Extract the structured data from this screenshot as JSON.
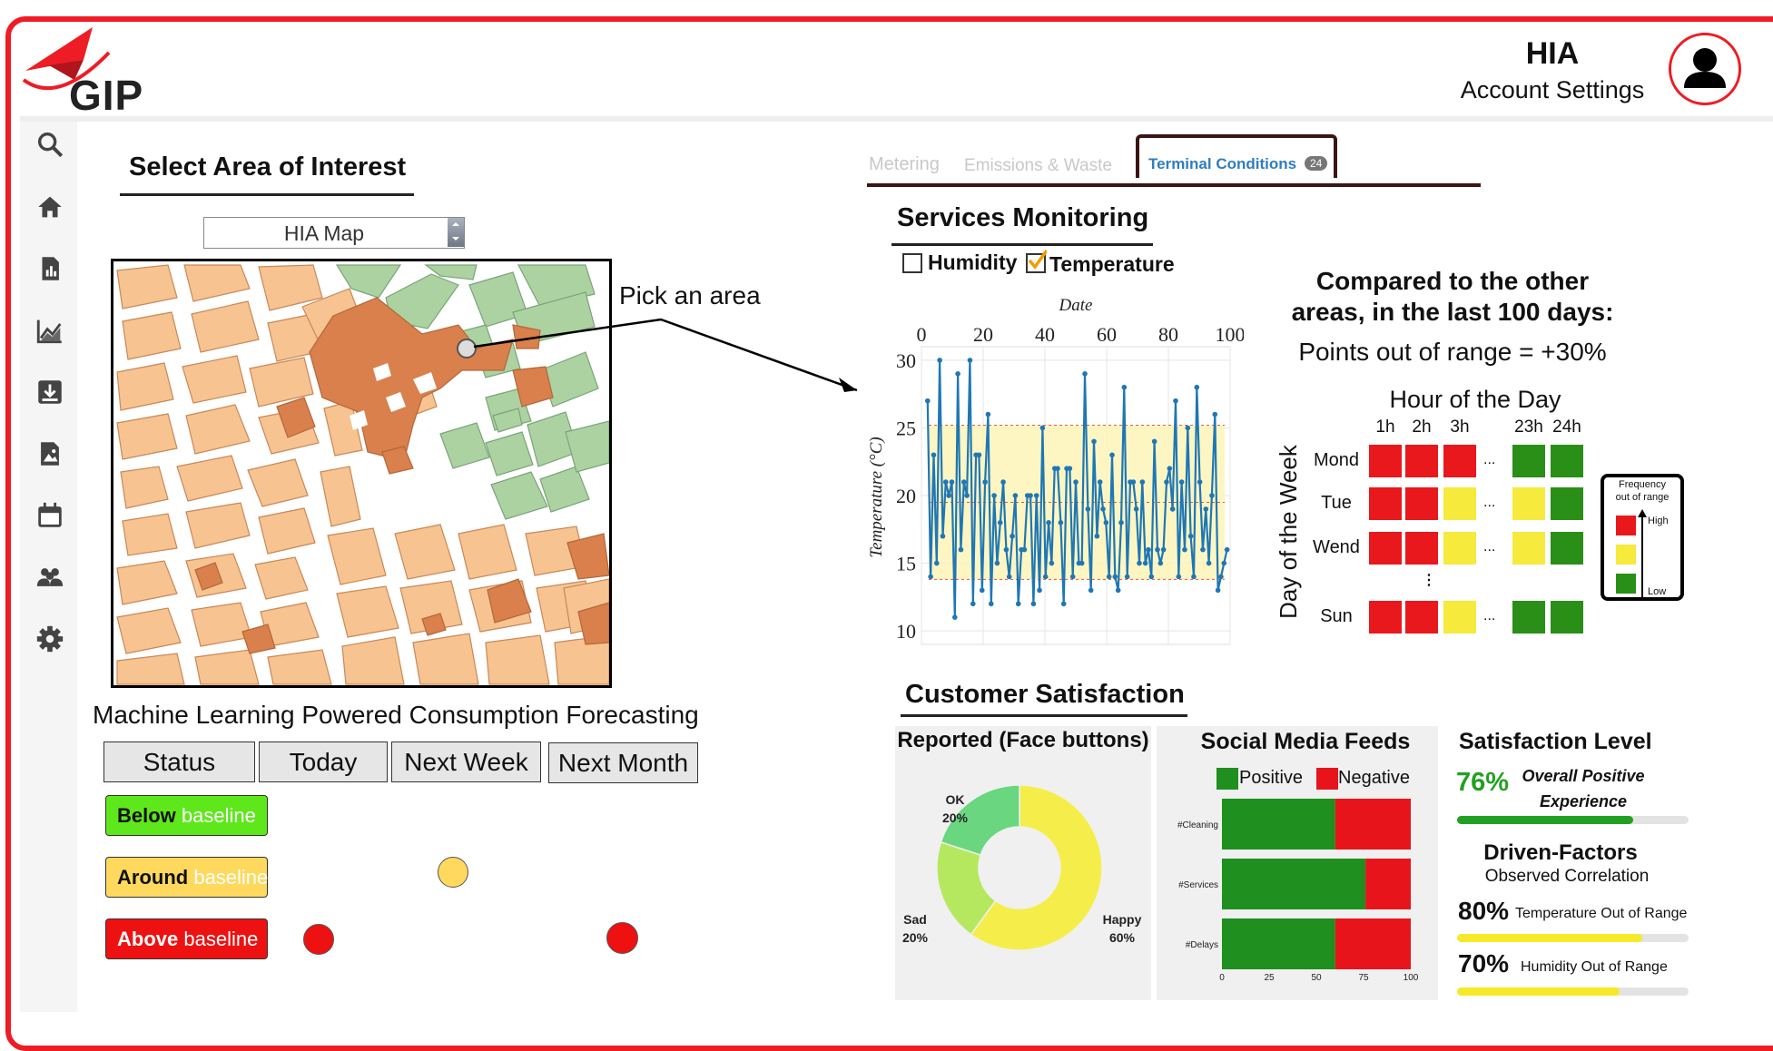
{
  "app": {
    "logo_text": "GIP",
    "account_name": "HIA",
    "account_settings": "Account Settings"
  },
  "sidebar": {
    "items": [
      {
        "icon": "search-icon"
      },
      {
        "icon": "home-icon"
      },
      {
        "icon": "report-icon"
      },
      {
        "icon": "chart-icon"
      },
      {
        "icon": "download-icon"
      },
      {
        "icon": "image-file-icon"
      },
      {
        "icon": "calendar-icon"
      },
      {
        "icon": "users-icon"
      },
      {
        "icon": "gear-icon"
      }
    ]
  },
  "area": {
    "title": "Select Area of Interest",
    "select_value": "HIA Map",
    "pick_label": "Pick an area"
  },
  "forecast": {
    "title": "Machine Learning Powered Consumption Forecasting",
    "buttons": [
      "Status",
      "Today",
      "Next Week",
      "Next Month"
    ],
    "legend": [
      {
        "bold": "Below",
        "sub": "baseline",
        "color": "#5ee81b"
      },
      {
        "bold": "Around",
        "sub": "baseline",
        "color": "#ffd95e"
      },
      {
        "bold": "Above",
        "sub": "baseline",
        "color": "#ee1111"
      }
    ]
  },
  "tabs": {
    "items": [
      "Metering",
      "Emissions & Waste",
      "Terminal Conditions"
    ],
    "active_badge": "24"
  },
  "services": {
    "title": "Services Monitoring",
    "humidity_label": "Humidity",
    "temperature_label": "Temperature",
    "humidity_checked": false,
    "temperature_checked": true
  },
  "comparison": {
    "title_line1": "Compared to the other",
    "title_line2": "areas, in the last 100 days:",
    "points_out": "Points out of range = +30%"
  },
  "heatmap": {
    "title": "Hour of the Day",
    "ylabel": "Day of the Week",
    "hours": [
      "1h",
      "2h",
      "3h",
      "23h",
      "24h"
    ],
    "days": [
      "Mond",
      "Tue",
      "Wend",
      "Sun"
    ],
    "ellipsis": "...",
    "vellipsis": "⋮",
    "colors": {
      "red": "#e8181c",
      "yellow": "#f6ea3d",
      "green": "#2a8f17"
    },
    "cells": [
      [
        "red",
        "red",
        "red",
        "green",
        "green"
      ],
      [
        "red",
        "red",
        "yellow",
        "yellow",
        "green"
      ],
      [
        "red",
        "red",
        "yellow",
        "yellow",
        "green"
      ],
      [
        "red",
        "red",
        "yellow",
        "green",
        "green"
      ]
    ],
    "legend_title_1": "Frequency",
    "legend_title_2": "out of range",
    "legend_high": "High",
    "legend_low": "Low"
  },
  "customer": {
    "title": "Customer Satisfaction",
    "reported_title": "Reported (Face buttons)",
    "social_title": "Social Media Feeds",
    "positive_label": "Positive",
    "negative_label": "Negative",
    "satisfaction_title": "Satisfaction Level",
    "sat_pct": "76%",
    "sat_text_1": "Overall Positive",
    "sat_text_2": "Experience",
    "sat_value": 0.76,
    "driven_title": "Driven-Factors",
    "driven_sub": "Observed Correlation",
    "factors": [
      {
        "pct": "80%",
        "label": "Temperature Out of Range",
        "value": 0.8
      },
      {
        "pct": "70%",
        "label": "Humidity Out of Range",
        "value": 0.7
      }
    ]
  },
  "chart_data": [
    {
      "type": "line",
      "title": "",
      "xlabel": "Date",
      "ylabel": "Temperature (°C)",
      "xlim": [
        0,
        100
      ],
      "ylim": [
        9,
        31
      ],
      "x_ticks": [
        0,
        20,
        40,
        60,
        80,
        100
      ],
      "y_ticks": [
        10,
        15,
        20,
        25,
        30
      ],
      "band": [
        13.8,
        25.2
      ],
      "reference_line": 19.5,
      "series": [
        {
          "color": "#1f77b4",
          "values": [
            27,
            14,
            23,
            15,
            30,
            17,
            21,
            20,
            21,
            11,
            29,
            16,
            21,
            20,
            30,
            12,
            23,
            23,
            13,
            21,
            26,
            12,
            20,
            15,
            18,
            21,
            16,
            14,
            17,
            20,
            12,
            16,
            16,
            20,
            20,
            12,
            20,
            13,
            25,
            14,
            18,
            15,
            22,
            22,
            18,
            12,
            22,
            22,
            14,
            21,
            15,
            15,
            29,
            19,
            13,
            24,
            17,
            21,
            19,
            18,
            14,
            23,
            14,
            13,
            18,
            28,
            14,
            21,
            21,
            19,
            15,
            21,
            15,
            16,
            14,
            24,
            16,
            15,
            16,
            21,
            22,
            19,
            27,
            14,
            21,
            16,
            25,
            17,
            14,
            28,
            21,
            16,
            19,
            15,
            20,
            26,
            13,
            14,
            15,
            16
          ]
        }
      ]
    },
    {
      "type": "pie",
      "title": "Reported (Face buttons)",
      "categories": [
        "Happy",
        "Sad",
        "OK"
      ],
      "values": [
        60,
        20,
        20
      ],
      "labels": [
        "60%",
        "20%",
        "20%"
      ],
      "colors": [
        "#f5ee4a",
        "#b5e85f",
        "#6ad67f"
      ]
    },
    {
      "type": "bar",
      "title": "Social Media Feeds",
      "orientation": "horizontal",
      "stacked": true,
      "categories": [
        "#Cleaning",
        "#Services",
        "#Delays"
      ],
      "series": [
        {
          "name": "Positive",
          "color": "#1f8f1f",
          "values": [
            60,
            76,
            60
          ]
        },
        {
          "name": "Negative",
          "color": "#e8141c",
          "values": [
            40,
            24,
            40
          ]
        }
      ],
      "xlim": [
        0,
        100
      ],
      "x_ticks": [
        0,
        25,
        50,
        75,
        100
      ]
    }
  ]
}
